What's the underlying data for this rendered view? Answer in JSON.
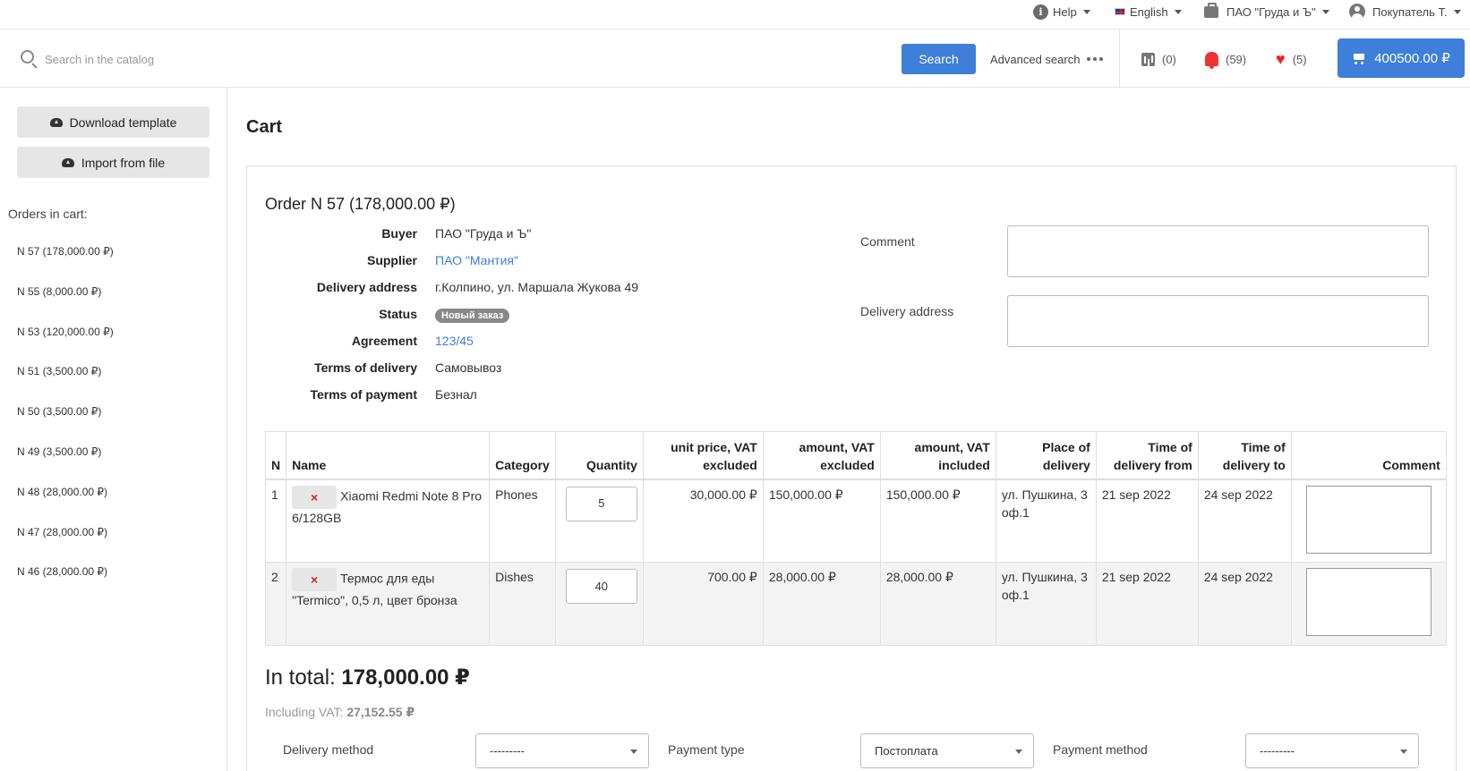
{
  "topbar": {
    "help_label": "Help",
    "language_label": "English",
    "company_label": "ПАО \"Груда и Ъ\"",
    "user_label": "Покупатель Т."
  },
  "search": {
    "placeholder": "Search in the catalog",
    "button_label": "Search",
    "advanced_label": "Advanced search"
  },
  "header_counters": {
    "compare": "(0)",
    "notifications": "(59)",
    "favorites": "(5)",
    "cart_total": "400500.00 ₽"
  },
  "sidebar": {
    "download_template": "Download template",
    "import_file": "Import from file",
    "orders_title": "Orders in cart:",
    "orders": [
      "N 57 (178,000.00 ₽)",
      "N 55 (8,000.00 ₽)",
      "N 53 (120,000.00 ₽)",
      "N 51 (3,500.00 ₽)",
      "N 50 (3,500.00 ₽)",
      "N 49 (3,500.00 ₽)",
      "N 48 (28,000.00 ₽)",
      "N 47 (28,000.00 ₽)",
      "N 46 (28,000.00 ₽)"
    ]
  },
  "page_title": "Cart",
  "order": {
    "title": "Order N 57 (178,000.00 ₽)",
    "fields": {
      "buyer_label": "Buyer",
      "buyer": "ПАО \"Груда и Ъ\"",
      "supplier_label": "Supplier",
      "supplier": "ПАО \"Мантия\"",
      "address_label": "Delivery address",
      "address": "г.Колпино, ул. Маршала Жукова 49",
      "status_label": "Status",
      "status": "Новый заказ",
      "agreement_label": "Agreement",
      "agreement": "123/45",
      "terms_delivery_label": "Terms of delivery",
      "terms_delivery": "Самовывоз",
      "terms_payment_label": "Terms of payment",
      "terms_payment": "Безнал"
    },
    "comment_label": "Comment",
    "delivery_address_label": "Delivery address"
  },
  "table": {
    "headers": {
      "n": "N",
      "name": "Name",
      "category": "Category",
      "quantity": "Quantity",
      "unit_price": "unit price, VAT excluded",
      "amount_excl": "amount, VAT excluded",
      "amount_incl": "amount, VAT included",
      "place": "Place of delivery",
      "time_from": "Time of delivery from",
      "time_to": "Time of delivery to",
      "comment": "Comment"
    },
    "rows": [
      {
        "n": "1",
        "name": "Xiaomi Redmi Note 8 Pro 6/128GB",
        "category": "Phones",
        "quantity": "5",
        "unit_price": "30,000.00 ₽",
        "amount_excl": "150,000.00 ₽",
        "amount_incl": "150,000.00 ₽",
        "place": "ул. Пушкина, 3 оф.1",
        "time_from": "21 sep 2022",
        "time_to": "24 sep 2022"
      },
      {
        "n": "2",
        "name": "Термос для еды \"Termico\", 0,5 л, цвет бронза",
        "category": "Dishes",
        "quantity": "40",
        "unit_price": "700.00 ₽",
        "amount_excl": "28,000.00 ₽",
        "amount_incl": "28,000.00 ₽",
        "place": "ул. Пушкина, 3 оф.1",
        "time_from": "21 sep 2022",
        "time_to": "24 sep 2022"
      }
    ],
    "delete_icon": "×"
  },
  "totals": {
    "total_prefix": "In total:",
    "total_value": "178,000.00 ₽",
    "vat_prefix": "Including VAT:",
    "vat_value": "27,152.55 ₽"
  },
  "bottom_form": {
    "delivery_method_label": "Delivery method",
    "delivery_method_value": "---------",
    "payment_type_label": "Payment type",
    "payment_type_value": "Постоплата",
    "payment_method_label": "Payment method",
    "payment_method_value": "---------"
  },
  "colors": {
    "accent": "#3d7fd9",
    "danger": "#e22",
    "badge": "#888888"
  }
}
